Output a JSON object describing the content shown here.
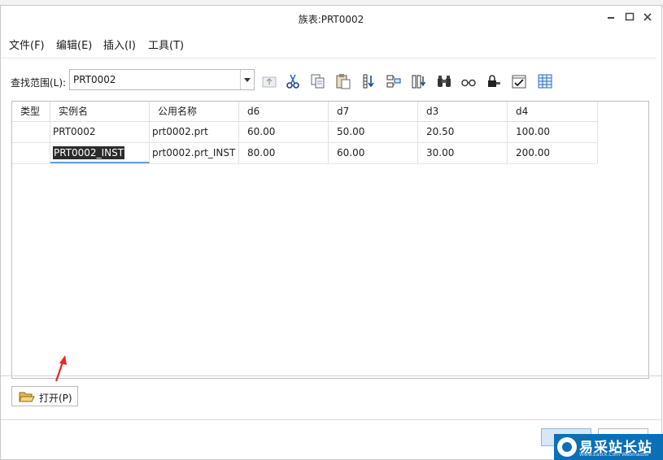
{
  "window": {
    "title": "族表:PRT0002"
  },
  "menu": {
    "items": [
      "文件(F)",
      "编辑(E)",
      "插入(I)",
      "工具(T)"
    ]
  },
  "search": {
    "label": "查找范围(L):",
    "value": "PRT0002"
  },
  "toolbar": {
    "icons": [
      "up-level-icon",
      "cut-icon",
      "copy-icon",
      "paste-icon",
      "insert-column-icon",
      "table-columns-icon",
      "add-item-icon",
      "find-icon",
      "verify-glasses-icon",
      "lock-icon",
      "checkbox-icon",
      "table-grid-icon"
    ]
  },
  "table": {
    "columns": [
      "类型",
      "实例名",
      "公用名称",
      "d6",
      "d7",
      "d3",
      "d4"
    ],
    "rows": [
      {
        "type": "",
        "instance": "PRT0002",
        "common": "prt0002.prt",
        "d6": "60.00",
        "d7": "50.00",
        "d3": "20.50",
        "d4": "100.00"
      },
      {
        "type": "",
        "instance": "PRT0002_INST",
        "common": "prt0002.prt_INST",
        "d6": "80.00",
        "d7": "60.00",
        "d3": "30.00",
        "d4": "200.00"
      }
    ]
  },
  "buttons": {
    "open_label": "打开(P)"
  },
  "watermark": {
    "text": "易采站长站",
    "sub": "Www.Easck.Com Webmaster"
  },
  "colors": {
    "selection_bg": "#2b2b2b",
    "edit_underline": "#5fa0d8",
    "arrow": "#e8262b",
    "watermark_bg": "#0b6fb5"
  }
}
